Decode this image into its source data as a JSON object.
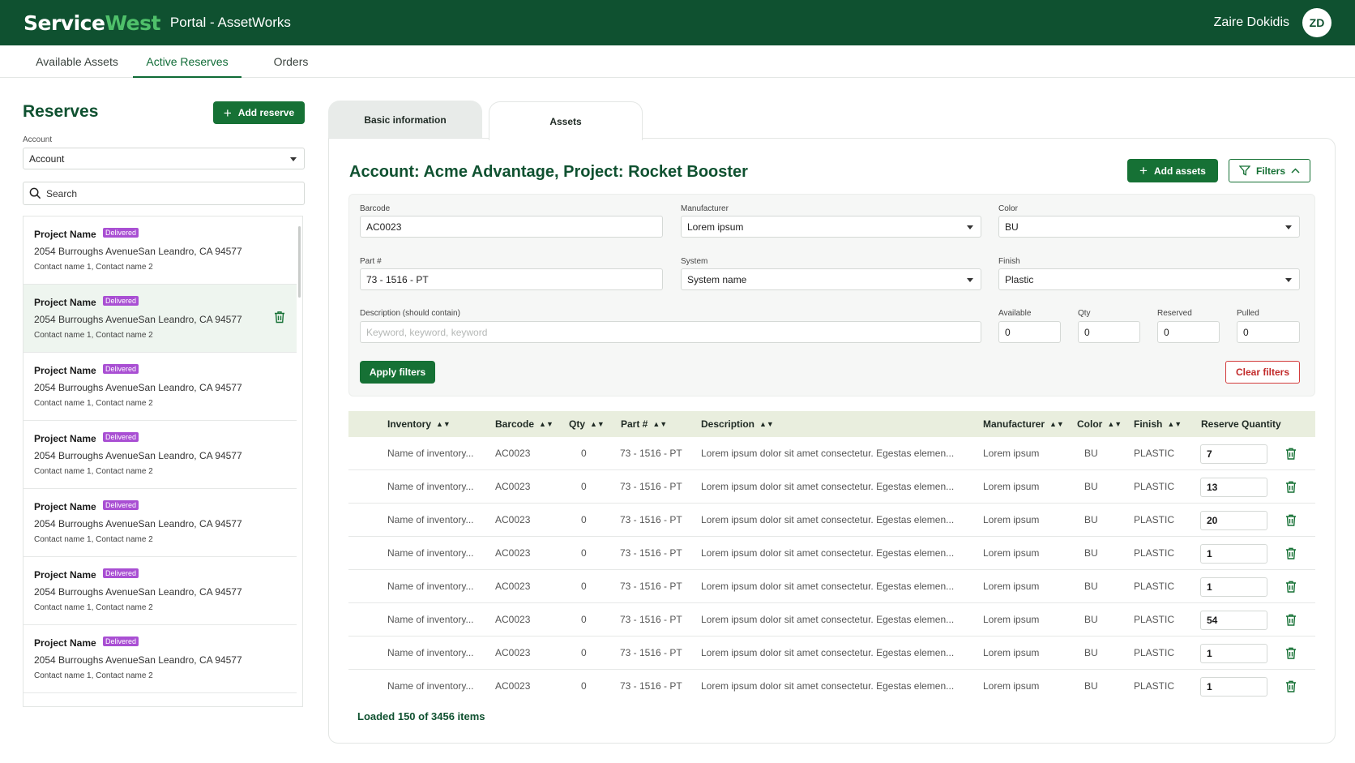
{
  "header": {
    "brand_main": "Service",
    "brand_accent": "West",
    "portal_title": "Portal - AssetWorks",
    "user_name": "Zaire Dokidis",
    "user_initials": "ZD",
    "colors": {
      "brand": "#0f5130",
      "accent": "#4fc06a"
    }
  },
  "nav": {
    "tabs": [
      {
        "label": "Available Assets",
        "active": false
      },
      {
        "label": "Active Reserves",
        "active": true
      },
      {
        "label": "Orders",
        "active": false
      }
    ]
  },
  "sidebar": {
    "title": "Reserves",
    "add_button": "Add reserve",
    "account_label": "Account",
    "account_value": "Account",
    "search_placeholder": "Search",
    "items": [
      {
        "name": "Project Name",
        "status": "Delivered",
        "address": "2054 Burroughs AvenueSan Leandro, CA 94577",
        "contacts": "Contact name 1, Contact name 2"
      },
      {
        "name": "Project Name",
        "status": "Delivered",
        "address": "2054 Burroughs AvenueSan Leandro, CA 94577",
        "contacts": "Contact name 1, Contact name 2"
      },
      {
        "name": "Project Name",
        "status": "Delivered",
        "address": "2054 Burroughs AvenueSan Leandro, CA 94577",
        "contacts": "Contact name 1, Contact name 2"
      },
      {
        "name": "Project Name",
        "status": "Delivered",
        "address": "2054 Burroughs AvenueSan Leandro, CA 94577",
        "contacts": "Contact name 1, Contact name 2"
      },
      {
        "name": "Project Name",
        "status": "Delivered",
        "address": "2054 Burroughs AvenueSan Leandro, CA 94577",
        "contacts": "Contact name 1, Contact name 2"
      },
      {
        "name": "Project Name",
        "status": "Delivered",
        "address": "2054 Burroughs AvenueSan Leandro, CA 94577",
        "contacts": "Contact name 1, Contact name 2"
      },
      {
        "name": "Project Name",
        "status": "Delivered",
        "address": "2054 Burroughs AvenueSan Leandro, CA 94577",
        "contacts": "Contact name 1, Contact name 2"
      }
    ]
  },
  "detail": {
    "tabs": [
      {
        "label": "Basic information",
        "active": false
      },
      {
        "label": "Assets",
        "active": true
      }
    ],
    "title": "Account: Acme Advantage,  Project: Rocket Booster",
    "add_assets": "Add assets",
    "filters_button": "Filters",
    "filters": {
      "barcode_label": "Barcode",
      "barcode_value": "AC0023",
      "manufacturer_label": "Manufacturer",
      "manufacturer_value": "Lorem ipsum",
      "color_label": "Color",
      "color_value": "BU",
      "part_label": "Part #",
      "part_value": "73 - 1516 - PT",
      "system_label": "System",
      "system_value": "System name",
      "finish_label": "Finish",
      "finish_value": "Plastic",
      "description_label": "Description (should contain)",
      "description_placeholder": "Keyword, keyword, keyword",
      "available_label": "Available",
      "available_value": "0",
      "qty_label": "Qty",
      "qty_value": "0",
      "reserved_label": "Reserved",
      "reserved_value": "0",
      "pulled_label": "Pulled",
      "pulled_value": "0",
      "apply": "Apply filters",
      "clear": "Clear filters"
    },
    "table": {
      "columns": [
        "Inventory",
        "Barcode",
        "Qty",
        "Part #",
        "Description",
        "Manufacturer",
        "Color",
        "Finish",
        "Reserve Quantity"
      ],
      "rows": [
        {
          "inventory": "Name of inventory...",
          "barcode": "AC0023",
          "qty": "0",
          "part": "73 - 1516 - PT",
          "description": "Lorem ipsum dolor sit amet consectetur. Egestas elemen...",
          "manufacturer": "Lorem ipsum",
          "color": "BU",
          "finish": "PLASTIC",
          "reserve": "7"
        },
        {
          "inventory": "Name of inventory...",
          "barcode": "AC0023",
          "qty": "0",
          "part": "73 - 1516 - PT",
          "description": "Lorem ipsum dolor sit amet consectetur. Egestas elemen...",
          "manufacturer": "Lorem ipsum",
          "color": "BU",
          "finish": "PLASTIC",
          "reserve": "13"
        },
        {
          "inventory": "Name of inventory...",
          "barcode": "AC0023",
          "qty": "0",
          "part": "73 - 1516 - PT",
          "description": "Lorem ipsum dolor sit amet consectetur. Egestas elemen...",
          "manufacturer": "Lorem ipsum",
          "color": "BU",
          "finish": "PLASTIC",
          "reserve": "20"
        },
        {
          "inventory": "Name of inventory...",
          "barcode": "AC0023",
          "qty": "0",
          "part": "73 - 1516 - PT",
          "description": "Lorem ipsum dolor sit amet consectetur. Egestas elemen...",
          "manufacturer": "Lorem ipsum",
          "color": "BU",
          "finish": "PLASTIC",
          "reserve": "1"
        },
        {
          "inventory": "Name of inventory...",
          "barcode": "AC0023",
          "qty": "0",
          "part": "73 - 1516 - PT",
          "description": "Lorem ipsum dolor sit amet consectetur. Egestas elemen...",
          "manufacturer": "Lorem ipsum",
          "color": "BU",
          "finish": "PLASTIC",
          "reserve": "1"
        },
        {
          "inventory": "Name of inventory...",
          "barcode": "AC0023",
          "qty": "0",
          "part": "73 - 1516 - PT",
          "description": "Lorem ipsum dolor sit amet consectetur. Egestas elemen...",
          "manufacturer": "Lorem ipsum",
          "color": "BU",
          "finish": "PLASTIC",
          "reserve": "54"
        },
        {
          "inventory": "Name of inventory...",
          "barcode": "AC0023",
          "qty": "0",
          "part": "73 - 1516 - PT",
          "description": "Lorem ipsum dolor sit amet consectetur. Egestas elemen...",
          "manufacturer": "Lorem ipsum",
          "color": "BU",
          "finish": "PLASTIC",
          "reserve": "1"
        },
        {
          "inventory": "Name of inventory...",
          "barcode": "AC0023",
          "qty": "0",
          "part": "73 - 1516 - PT",
          "description": "Lorem ipsum dolor sit amet consectetur. Egestas elemen...",
          "manufacturer": "Lorem ipsum",
          "color": "BU",
          "finish": "PLASTIC",
          "reserve": "1"
        }
      ]
    },
    "loaded_text": "Loaded 150 of 3456 items"
  }
}
